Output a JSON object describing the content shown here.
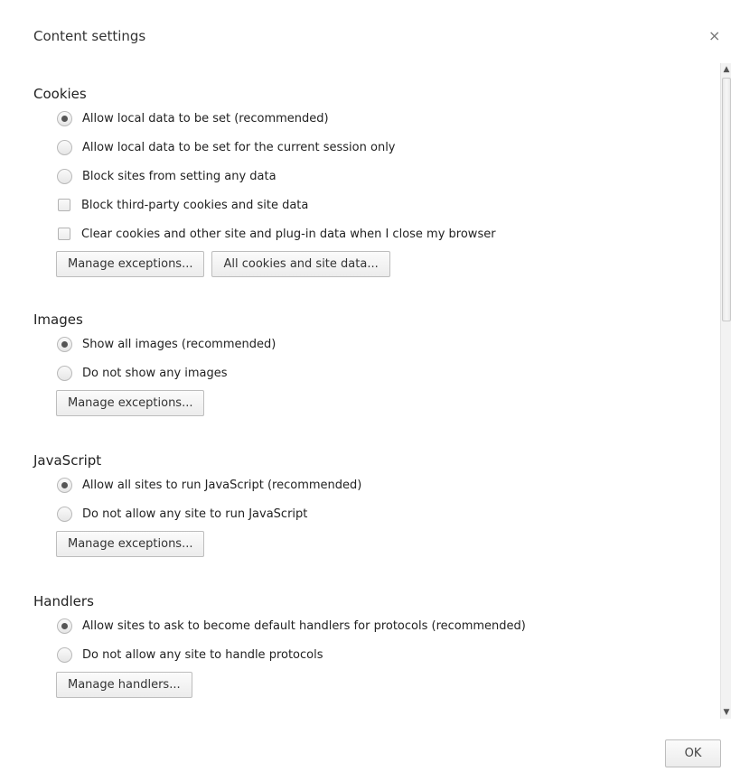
{
  "dialog": {
    "title": "Content settings",
    "close_glyph": "×",
    "ok_label": "OK"
  },
  "cookies": {
    "title": "Cookies",
    "options": [
      {
        "type": "radio",
        "label": "Allow local data to be set (recommended)",
        "checked": true
      },
      {
        "type": "radio",
        "label": "Allow local data to be set for the current session only",
        "checked": false
      },
      {
        "type": "radio",
        "label": "Block sites from setting any data",
        "checked": false
      },
      {
        "type": "checkbox",
        "label": "Block third-party cookies and site data",
        "checked": false
      },
      {
        "type": "checkbox",
        "label": "Clear cookies and other site and plug-in data when I close my browser",
        "checked": false
      }
    ],
    "buttons": [
      "Manage exceptions...",
      "All cookies and site data..."
    ]
  },
  "images": {
    "title": "Images",
    "options": [
      {
        "type": "radio",
        "label": "Show all images (recommended)",
        "checked": true
      },
      {
        "type": "radio",
        "label": "Do not show any images",
        "checked": false
      }
    ],
    "buttons": [
      "Manage exceptions..."
    ]
  },
  "javascript": {
    "title": "JavaScript",
    "options": [
      {
        "type": "radio",
        "label": "Allow all sites to run JavaScript (recommended)",
        "checked": true
      },
      {
        "type": "radio",
        "label": "Do not allow any site to run JavaScript",
        "checked": false
      }
    ],
    "buttons": [
      "Manage exceptions..."
    ]
  },
  "handlers": {
    "title": "Handlers",
    "options": [
      {
        "type": "radio",
        "label": "Allow sites to ask to become default handlers for protocols (recommended)",
        "checked": true
      },
      {
        "type": "radio",
        "label": "Do not allow any site to handle protocols",
        "checked": false
      }
    ],
    "buttons": [
      "Manage handlers..."
    ]
  },
  "scrollbar": {
    "up_glyph": "▲",
    "down_glyph": "▼"
  }
}
